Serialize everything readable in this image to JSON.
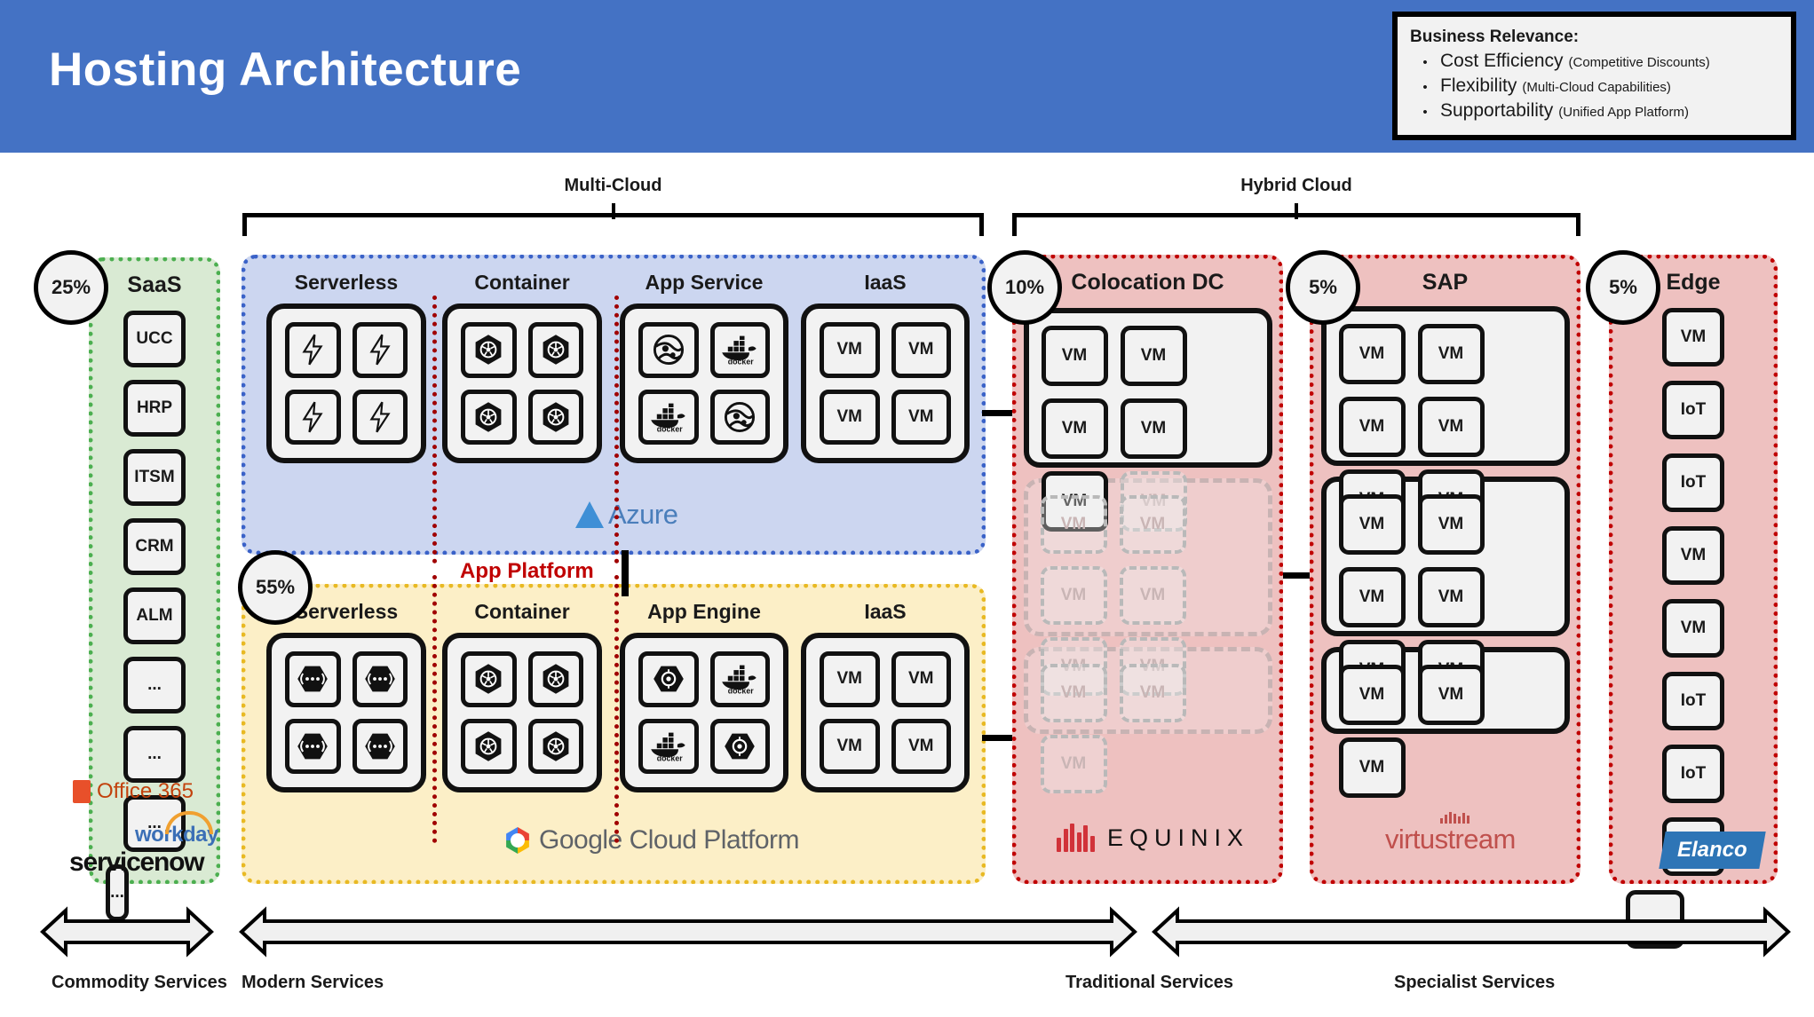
{
  "header": {
    "title": "Hosting Architecture",
    "business_relevance": {
      "title": "Business Relevance:",
      "items": [
        {
          "bullet": "•",
          "label": "Cost Efficiency",
          "sub": "(Competitive Discounts)"
        },
        {
          "bullet": "•",
          "label": "Flexibility",
          "sub": "(Multi-Cloud Capabilities)"
        },
        {
          "bullet": "•",
          "label": "Supportability",
          "sub": "(Unified App Platform)"
        }
      ]
    }
  },
  "brackets": [
    {
      "label": "Multi-Cloud"
    },
    {
      "label": "Hybrid Cloud"
    }
  ],
  "app_platform_label": "App Platform",
  "columns": {
    "saas": {
      "title": "SaaS",
      "badge": "25%",
      "tiles": [
        "UCC",
        "HRP",
        "ITSM",
        "CRM",
        "ALM",
        "...",
        "...",
        "...",
        "..."
      ],
      "logos": [
        "Office 365",
        "workday",
        "servicenow"
      ]
    },
    "azure": {
      "badge": "",
      "logo": "Azure",
      "services": [
        {
          "title": "Serverless",
          "icon": "azure-function-bolt-icon",
          "cells": [
            "bolt",
            "bolt",
            "bolt",
            "bolt"
          ]
        },
        {
          "title": "Container",
          "icon": "kubernetes-icon",
          "cells": [
            "k8s",
            "k8s",
            "k8s",
            "k8s"
          ]
        },
        {
          "title": "App Service",
          "icon": "app-service-globe-icon",
          "cells": [
            "globe",
            "docker",
            "docker",
            "globe"
          ]
        },
        {
          "title": "IaaS",
          "icon": "vm-icon",
          "cells": [
            "VM",
            "VM",
            "VM",
            "VM"
          ]
        }
      ]
    },
    "gcp": {
      "badge": "55%",
      "logo": "Google Cloud Platform",
      "services": [
        {
          "title": "Serverless",
          "icon": "cloud-function-icon",
          "cells": [
            "fn",
            "fn",
            "fn",
            "fn"
          ]
        },
        {
          "title": "Container",
          "icon": "kubernetes-icon",
          "cells": [
            "k8s",
            "k8s",
            "k8s",
            "k8s"
          ]
        },
        {
          "title": "App Engine",
          "icon": "app-engine-icon",
          "cells": [
            "gae",
            "docker",
            "docker",
            "gae"
          ]
        },
        {
          "title": "IaaS",
          "icon": "vm-icon",
          "cells": [
            "VM",
            "VM",
            "VM",
            "VM"
          ]
        }
      ]
    },
    "colocation": {
      "title": "Colocation DC",
      "badge": "10%",
      "logo": "EQUINIX",
      "groups": [
        {
          "style": "solid",
          "cells": [
            {
              "label": "VM",
              "state": "solid"
            },
            {
              "label": "VM",
              "state": "solid"
            },
            {
              "label": "VM",
              "state": "solid"
            },
            {
              "label": "VM",
              "state": "solid"
            },
            {
              "label": "VM",
              "state": "solid"
            },
            {
              "label": "VM",
              "state": "ghost"
            }
          ]
        },
        {
          "style": "ghost",
          "cells": [
            {
              "label": "VM",
              "state": "ghost"
            },
            {
              "label": "VM",
              "state": "ghost"
            },
            {
              "label": "VM",
              "state": "ghost"
            },
            {
              "label": "VM",
              "state": "ghost"
            },
            {
              "label": "VM",
              "state": "ghost"
            },
            {
              "label": "VM",
              "state": "ghost"
            }
          ]
        },
        {
          "style": "ghost",
          "cells": [
            {
              "label": "VM",
              "state": "ghost"
            },
            {
              "label": "VM",
              "state": "ghost"
            },
            {
              "label": "VM",
              "state": "ghost"
            }
          ]
        }
      ]
    },
    "sap": {
      "title": "SAP",
      "badge": "5%",
      "logo": "virtustream",
      "groups": [
        {
          "style": "solid",
          "cells": [
            {
              "label": "VM",
              "state": "solid"
            },
            {
              "label": "VM",
              "state": "solid"
            },
            {
              "label": "VM",
              "state": "solid"
            },
            {
              "label": "VM",
              "state": "solid"
            },
            {
              "label": "VM",
              "state": "solid"
            },
            {
              "label": "VM",
              "state": "solid"
            }
          ]
        },
        {
          "style": "solid",
          "cells": [
            {
              "label": "VM",
              "state": "solid"
            },
            {
              "label": "VM",
              "state": "solid"
            },
            {
              "label": "VM",
              "state": "solid"
            },
            {
              "label": "VM",
              "state": "solid"
            },
            {
              "label": "VM",
              "state": "solid"
            },
            {
              "label": "VM",
              "state": "solid"
            }
          ]
        },
        {
          "style": "solid",
          "cells": [
            {
              "label": "VM",
              "state": "solid"
            },
            {
              "label": "VM",
              "state": "solid"
            },
            {
              "label": "VM",
              "state": "solid"
            }
          ]
        }
      ]
    },
    "edge": {
      "title": "Edge",
      "badge": "5%",
      "logo": "Elanco",
      "tiles": [
        "VM",
        "IoT",
        "IoT",
        "VM",
        "VM",
        "IoT",
        "IoT",
        "VM",
        "..."
      ]
    }
  },
  "bottom_arrows": [
    {
      "label": "Commodity Services",
      "heads": "both"
    },
    {
      "label": "Modern Services",
      "heads": "both"
    },
    {
      "label": "Traditional Services",
      "heads": "both"
    },
    {
      "label": "Specialist Services",
      "heads": "both"
    }
  ]
}
